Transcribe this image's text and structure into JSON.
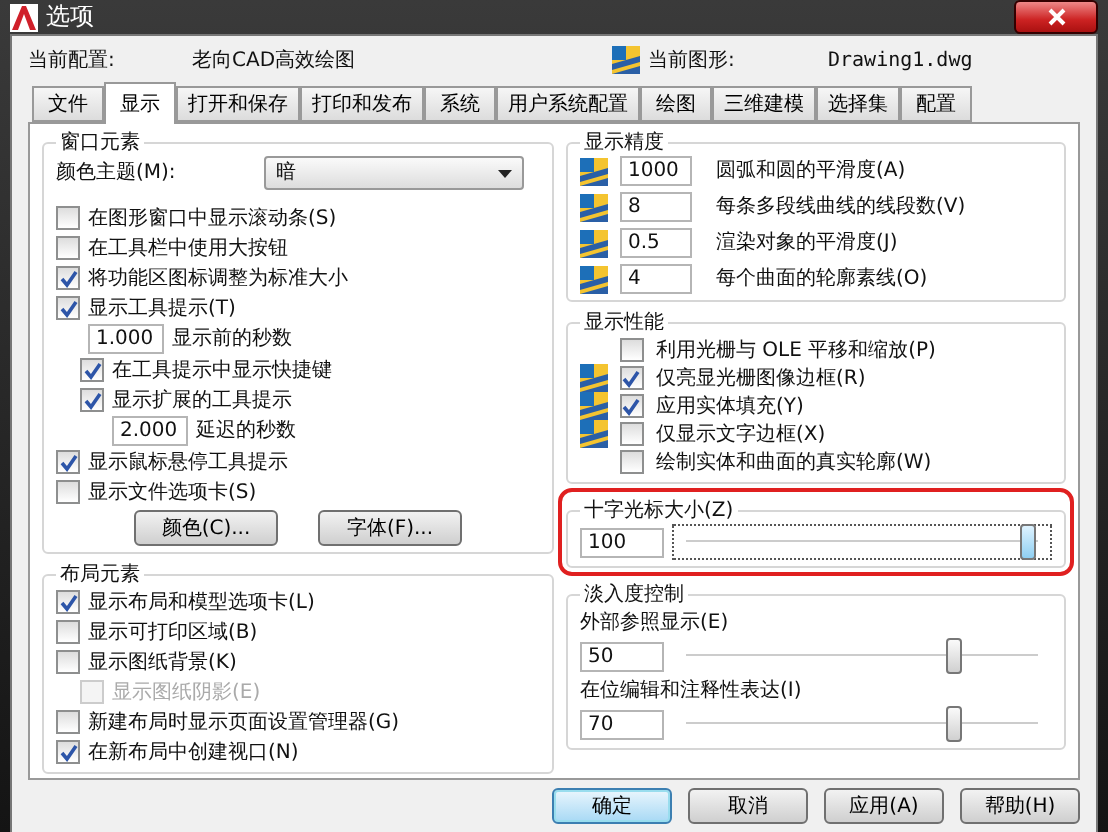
{
  "window": {
    "title": "选项"
  },
  "profile": {
    "label": "当前配置:",
    "value": "老向CAD高效绘图"
  },
  "drawing": {
    "label": "当前图形:",
    "value": "Drawing1.dwg"
  },
  "tabs": [
    {
      "label": "文件",
      "selected": false
    },
    {
      "label": "显示",
      "selected": true
    },
    {
      "label": "打开和保存",
      "selected": false
    },
    {
      "label": "打印和发布",
      "selected": false
    },
    {
      "label": "系统",
      "selected": false
    },
    {
      "label": "用户系统配置",
      "selected": false
    },
    {
      "label": "绘图",
      "selected": false
    },
    {
      "label": "三维建模",
      "selected": false
    },
    {
      "label": "选择集",
      "selected": false
    },
    {
      "label": "配置",
      "selected": false
    }
  ],
  "window_elements": {
    "title": "窗口元素",
    "color_theme": {
      "label": "颜色主题(M):",
      "value": "暗"
    },
    "items": [
      {
        "kind": "checkbox",
        "label": "在图形窗口中显示滚动条(S)",
        "checked": false,
        "disabled": false
      },
      {
        "kind": "checkbox",
        "label": "在工具栏中使用大按钮",
        "checked": false,
        "disabled": false
      },
      {
        "kind": "checkbox",
        "label": "将功能区图标调整为标准大小",
        "checked": true,
        "disabled": false
      },
      {
        "kind": "checkbox",
        "label": "显示工具提示(T)",
        "checked": true,
        "disabled": false,
        "children": [
          {
            "kind": "field",
            "value": "1.000",
            "label": "显示前的秒数"
          },
          {
            "kind": "checkbox",
            "label": "在工具提示中显示快捷键",
            "checked": true,
            "disabled": false
          },
          {
            "kind": "checkbox",
            "label": "显示扩展的工具提示",
            "checked": true,
            "disabled": false,
            "children": [
              {
                "kind": "field",
                "value": "2.000",
                "label": "延迟的秒数"
              }
            ]
          }
        ]
      },
      {
        "kind": "checkbox",
        "label": "显示鼠标悬停工具提示",
        "checked": true,
        "disabled": false
      },
      {
        "kind": "checkbox",
        "label": "显示文件选项卡(S)",
        "checked": false,
        "disabled": false
      }
    ],
    "buttons": [
      "颜色(C)...",
      "字体(F)..."
    ]
  },
  "layout_elements": {
    "title": "布局元素",
    "items": [
      {
        "kind": "checkbox",
        "label": "显示布局和模型选项卡(L)",
        "checked": true,
        "disabled": false
      },
      {
        "kind": "checkbox",
        "label": "显示可打印区域(B)",
        "checked": false,
        "disabled": false
      },
      {
        "kind": "checkbox",
        "label": "显示图纸背景(K)",
        "checked": false,
        "disabled": false,
        "children": [
          {
            "kind": "checkbox",
            "label": "显示图纸阴影(E)",
            "checked": false,
            "disabled": true
          }
        ]
      },
      {
        "kind": "checkbox",
        "label": "新建布局时显示页面设置管理器(G)",
        "checked": false,
        "disabled": false
      },
      {
        "kind": "checkbox",
        "label": "在新布局中创建视口(N)",
        "checked": true,
        "disabled": false
      }
    ]
  },
  "display_resolution": {
    "title": "显示精度",
    "rows": [
      {
        "value": "1000",
        "label": "圆弧和圆的平滑度(A)"
      },
      {
        "value": "8",
        "label": "每条多段线曲线的线段数(V)"
      },
      {
        "value": "0.5",
        "label": "渲染对象的平滑度(J)"
      },
      {
        "value": "4",
        "label": "每个曲面的轮廓素线(O)"
      }
    ]
  },
  "display_performance": {
    "title": "显示性能",
    "items": [
      {
        "label": "利用光栅与 OLE 平移和缩放(P)",
        "checked": false,
        "saved_in_drawing": false
      },
      {
        "label": "仅亮显光栅图像边框(R)",
        "checked": true,
        "saved_in_drawing": true
      },
      {
        "label": "应用实体填充(Y)",
        "checked": true,
        "saved_in_drawing": true
      },
      {
        "label": "仅显示文字边框(X)",
        "checked": false,
        "saved_in_drawing": true
      },
      {
        "label": "绘制实体和曲面的真实轮廓(W)",
        "checked": false,
        "saved_in_drawing": false
      }
    ]
  },
  "crosshair_size": {
    "title": "十字光标大小(Z)",
    "value": "100",
    "level": 0.97,
    "highlighted": true,
    "focused": true
  },
  "fade_control": {
    "title": "淡入度控制",
    "sliders": [
      {
        "label": "外部参照显示(E)",
        "value": "50",
        "level": 0.76
      },
      {
        "label": "在位编辑和注释性表达(I)",
        "value": "70",
        "level": 0.76
      }
    ]
  },
  "buttons": [
    {
      "label": "确定",
      "default": true
    },
    {
      "label": "取消",
      "default": false
    },
    {
      "label": "应用(A)",
      "default": false
    },
    {
      "label": "帮助(H)",
      "default": false
    }
  ]
}
